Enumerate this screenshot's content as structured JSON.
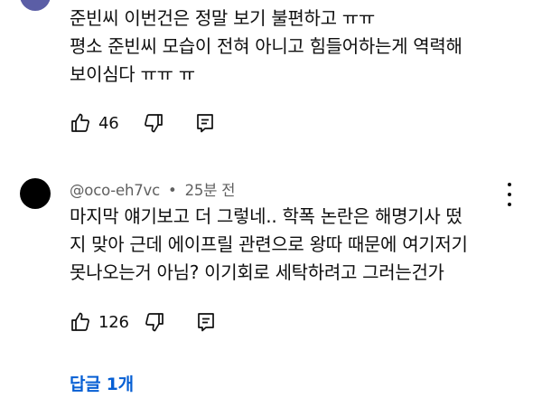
{
  "comment_1": {
    "text": "준빈씨 이번건은 정말 보기 불편하고 ㅠㅠ\n평소 준빈씨 모습이 전혀 아니고 힘들어하는게 역력해\n보이심다 ㅠㅠ  ㅠ",
    "likes": "46",
    "avatar_color": "#5b5ea6"
  },
  "comment_2": {
    "author": "@oco-eh7vc",
    "separator": "•",
    "time": "25분 전",
    "text": "마지막 얘기보고 더 그렇네.. 학폭 논란은 해명기사 떴\n지 맞아 근데 에이프릴 관련으로 왕따 때문에 여기저기\n못나오는거 아님? 이기회로 세탁하려고 그러는건가",
    "likes": "126",
    "avatar_color": "#000000",
    "replies_label": "답글 1개"
  },
  "colors": {
    "link": "#065fd4",
    "meta": "#606060",
    "text": "#0f0f0f"
  },
  "icons": [
    "thumbs-up-icon",
    "thumbs-down-icon",
    "reply-icon",
    "more-vert-icon"
  ]
}
